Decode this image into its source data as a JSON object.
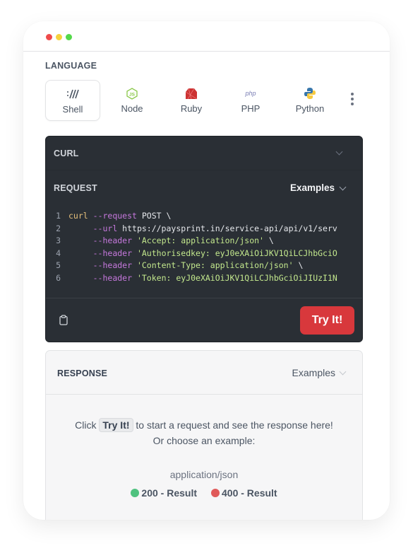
{
  "window": {
    "controls": [
      "close",
      "minimize",
      "maximize"
    ]
  },
  "language": {
    "label": "LANGUAGE",
    "tabs": [
      {
        "name": "Shell",
        "icon": "shell-icon",
        "active": true
      },
      {
        "name": "Node",
        "icon": "nodejs-icon",
        "active": false
      },
      {
        "name": "Ruby",
        "icon": "ruby-icon",
        "active": false
      },
      {
        "name": "PHP",
        "icon": "php-icon",
        "active": false
      },
      {
        "name": "Python",
        "icon": "python-icon",
        "active": false
      }
    ],
    "more_icon": "more-vertical-icon",
    "php_glyph": "php"
  },
  "code_panel": {
    "title": "CURL",
    "request_label": "REQUEST",
    "examples_label": "Examples",
    "lines": [
      {
        "n": "1",
        "parts": [
          [
            "kw",
            "curl"
          ],
          [
            "tx",
            " "
          ],
          [
            "fl",
            "--request"
          ],
          [
            "tx",
            " POST \\"
          ]
        ]
      },
      {
        "n": "2",
        "parts": [
          [
            "tx",
            "     "
          ],
          [
            "fl",
            "--url"
          ],
          [
            "tx",
            " https://paysprint.in/service-api/api/v1/serv"
          ]
        ]
      },
      {
        "n": "3",
        "parts": [
          [
            "tx",
            "     "
          ],
          [
            "fl",
            "--header"
          ],
          [
            "tx",
            " "
          ],
          [
            "st",
            "'Accept: application/json'"
          ],
          [
            "tx",
            " \\"
          ]
        ]
      },
      {
        "n": "4",
        "parts": [
          [
            "tx",
            "     "
          ],
          [
            "fl",
            "--header"
          ],
          [
            "tx",
            " "
          ],
          [
            "st",
            "'Authorisedkey: eyJ0eXAiOiJKV1QiLCJhbGciO"
          ]
        ]
      },
      {
        "n": "5",
        "parts": [
          [
            "tx",
            "     "
          ],
          [
            "fl",
            "--header"
          ],
          [
            "tx",
            " "
          ],
          [
            "st",
            "'Content-Type: application/json'"
          ],
          [
            "tx",
            " \\"
          ]
        ]
      },
      {
        "n": "6",
        "parts": [
          [
            "tx",
            "     "
          ],
          [
            "fl",
            "--header"
          ],
          [
            "tx",
            " "
          ],
          [
            "st",
            "'Token: eyJ0eXAiOiJKV1QiLCJhbGciOiJIUzI1N"
          ]
        ]
      }
    ],
    "copy_icon": "clipboard-icon",
    "try_button": "Try It!"
  },
  "response": {
    "title": "RESPONSE",
    "examples_label": "Examples",
    "prompt_before": "Click ",
    "prompt_kbd": "Try It!",
    "prompt_after": " to start a request and see the response here!",
    "prompt_line2": "Or choose an example:",
    "mime": "application/json",
    "results": [
      {
        "label": "200 - Result",
        "color": "#4fc27f"
      },
      {
        "label": "400 - Result",
        "color": "#e05a5a"
      }
    ]
  }
}
